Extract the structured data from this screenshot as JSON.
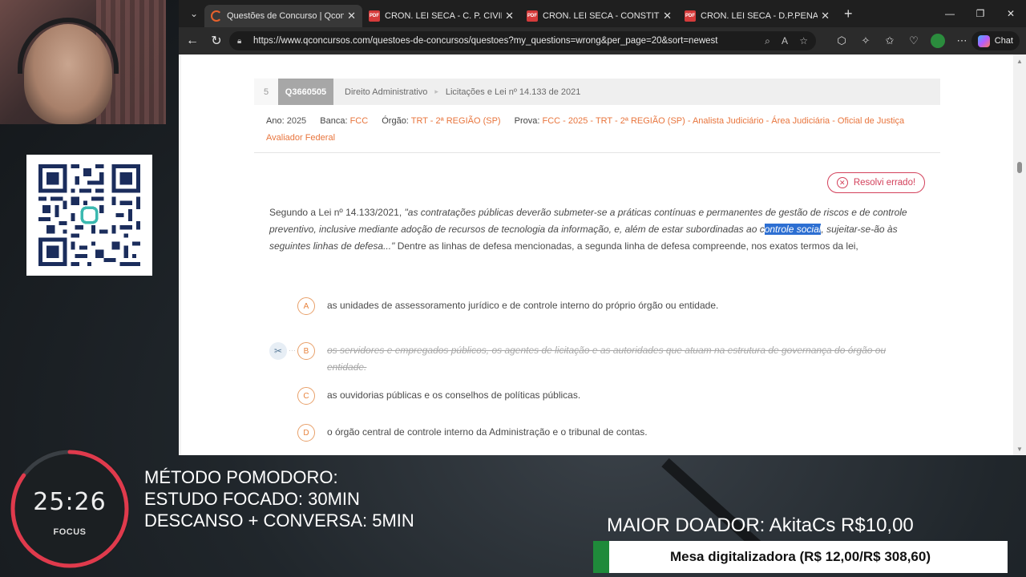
{
  "browser": {
    "tabs": [
      {
        "title": "Questões de Concurso | Qconcursos",
        "icon": "qconcursos-icon",
        "active": true
      },
      {
        "title": "CRON. LEI SECA - C. P. CIVIL.pdf",
        "icon": "pdf-icon",
        "active": false
      },
      {
        "title": "CRON. LEI SECA - CONSTITUCIONAL",
        "icon": "pdf-icon",
        "active": false
      },
      {
        "title": "CRON. LEI SECA - D.P.PENAL.pdf",
        "icon": "pdf-icon",
        "active": false
      }
    ],
    "url": "https://www.qconcursos.com/questoes-de-concursos/questoes?my_questions=wrong&per_page=20&sort=newest",
    "chat_label": "Chat"
  },
  "question": {
    "number": "5",
    "id": "Q3660505",
    "subject": "Direito Administrativo",
    "topic": "Licitações e Lei nº 14.133 de 2021",
    "meta": {
      "ano_label": "Ano:",
      "ano": "2025",
      "banca_label": "Banca:",
      "banca": "FCC",
      "orgao_label": "Órgão:",
      "orgao": "TRT - 2ª REGIÃO (SP)",
      "prova_label": "Prova:",
      "prova": "FCC - 2025 - TRT - 2ª REGIÃO (SP) - Analista Judiciário - Área Judiciária - Oficial de Justiça Avaliador Federal"
    },
    "result": "Resolvi errado!",
    "statement": {
      "intro": "Segundo a Lei nº 14.133/2021, ",
      "quote_a": "\"as contratações públicas deverão submeter-se a práticas contínuas e permanentes de gestão de riscos e de controle preventivo, inclusive mediante adoção de recursos de tecnologia da informação, e, além de estar subordinadas ao c",
      "highlight": "ontrole social",
      "quote_b": ", sujeitar-se-ão às seguintes linhas de defesa...\"",
      "tail": " Dentre as linhas de defesa mencionadas, a segunda linha de defesa compreende, nos exatos termos da lei,"
    },
    "alternatives": [
      {
        "letter": "A",
        "text": "as unidades de assessoramento jurídico e de controle interno do próprio órgão ou entidade.",
        "struck": false
      },
      {
        "letter": "B",
        "text": "os servidores e empregados públicos, os agentes de licitação e as autoridades que atuam na estrutura de governança do órgão ou entidade.",
        "struck": true
      },
      {
        "letter": "C",
        "text": "as ouvidorias públicas e os conselhos de políticas públicas.",
        "struck": false
      },
      {
        "letter": "D",
        "text": "o órgão central de controle interno da Administração e o tribunal de contas.",
        "struck": false
      }
    ]
  },
  "overlay": {
    "timer": {
      "time": "25:26",
      "mode": "FOCUS",
      "progress": 0.85
    },
    "pomodoro_lines": [
      "MÉTODO POMODORO:",
      "ESTUDO FOCADO: 30MIN",
      "DESCANSO + CONVERSA: 5MIN"
    ],
    "donor": "MAIOR DOADOR: AkitaCs R$10,00",
    "goal": {
      "label": "Mesa digitalizadora (R$ 12,00/R$ 308,60)",
      "progress": 0.039
    }
  },
  "colors": {
    "accent": "#e8753d",
    "error": "#d3415b",
    "timer_ring": "#e03a4c",
    "goal_fill": "#1f8a3a"
  }
}
